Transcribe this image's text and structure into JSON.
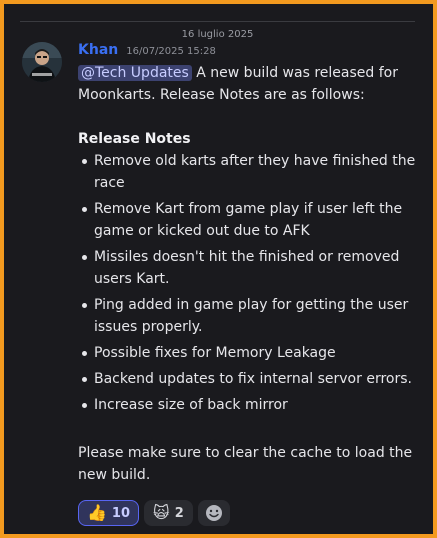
{
  "date_divider": "16 luglio 2025",
  "message": {
    "author": "Khan",
    "timestamp": "16/07/2025 15:28",
    "mention": "@Tech Updates",
    "intro": " A new build was released for Moonkarts. Release Notes are as follows:",
    "section_title": "Release Notes",
    "notes": [
      "Remove old karts after they have finished the race",
      "Remove Kart from game play if user left the game or kicked out due to AFK",
      "Missiles doesn't hit the finished or removed users Kart.",
      "Ping added in game play for getting the user issues properly.",
      "Possible fixes for Memory Leakage",
      "Backend updates to fix internal servor errors.",
      "Increase size of back mirror"
    ],
    "footer": "Please make sure to clear the cache to load the new build."
  },
  "reactions": [
    {
      "emoji": "👍",
      "count": "10",
      "active": true
    },
    {
      "emoji": "🙀",
      "count": "2",
      "active": false
    }
  ],
  "colors": {
    "border": "#f39a1f",
    "background": "#1a1a1e",
    "author": "#3a6ff2",
    "mention_bg": "#3c4270"
  }
}
